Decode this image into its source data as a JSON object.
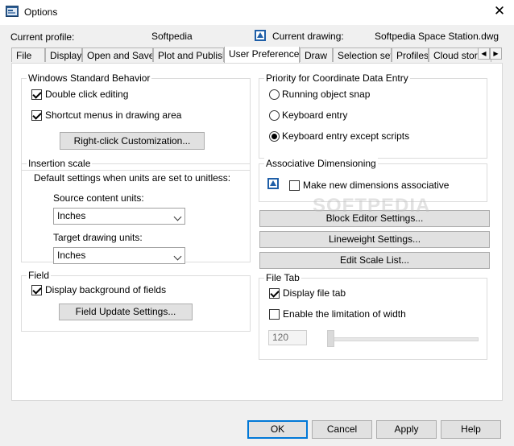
{
  "window": {
    "title": "Options",
    "close_glyph": "✕"
  },
  "profile": {
    "current_profile_label": "Current profile:",
    "current_profile_value": "Softpedia",
    "current_drawing_label": "Current drawing:",
    "current_drawing_value": "Softpedia Space Station.dwg"
  },
  "tabs": [
    {
      "label": "File"
    },
    {
      "label": "Display"
    },
    {
      "label": "Open and Save"
    },
    {
      "label": "Plot and Publish"
    },
    {
      "label": "User Preferences"
    },
    {
      "label": "Draw"
    },
    {
      "label": "Selection set"
    },
    {
      "label": "Profiles"
    },
    {
      "label": "Cloud stora"
    }
  ],
  "active_tab": "User Preferences",
  "tab_scroll": {
    "left": "◀",
    "right": "▶"
  },
  "windows_behavior": {
    "title": "Windows Standard Behavior",
    "double_click_editing": {
      "label": "Double click editing",
      "checked": true
    },
    "shortcut_menus": {
      "label": "Shortcut menus in drawing area",
      "checked": true
    },
    "right_click_button": "Right-click Customization..."
  },
  "insertion_scale": {
    "title": "Insertion scale",
    "description": "Default settings when units are set to unitless:",
    "source_label": "Source content units:",
    "source_value": "Inches",
    "target_label": "Target drawing units:",
    "target_value": "Inches"
  },
  "field": {
    "title": "Field",
    "display_background": {
      "label": "Display background of fields",
      "checked": true
    },
    "update_button": "Field Update Settings..."
  },
  "priority": {
    "title": "Priority for Coordinate Data Entry",
    "options": [
      {
        "label": "Running object snap",
        "selected": false
      },
      {
        "label": "Keyboard entry",
        "selected": false
      },
      {
        "label": "Keyboard entry except scripts",
        "selected": true
      }
    ]
  },
  "associative": {
    "title": "Associative Dimensioning",
    "make_associative": {
      "label": "Make new dimensions associative",
      "checked": false
    }
  },
  "side_buttons": {
    "block_editor": "Block Editor Settings...",
    "lineweight": "Lineweight Settings...",
    "edit_scale_list": "Edit Scale List..."
  },
  "file_tab": {
    "title": "File Tab",
    "display_file_tab": {
      "label": "Display file tab",
      "checked": true
    },
    "limit_width": {
      "label": "Enable the limitation of width",
      "checked": false
    },
    "width_value": "120",
    "slider_level": 0
  },
  "watermark": "SOFTPEDIA",
  "footer": {
    "ok": "OK",
    "cancel": "Cancel",
    "apply": "Apply",
    "help": "Help"
  },
  "icons": {
    "app": "autocad-options-icon",
    "drawing": "dwg-file-icon"
  },
  "colors": {
    "accent": "#0078d7",
    "panel": "#ffffff",
    "chrome": "#f0f0f0"
  }
}
